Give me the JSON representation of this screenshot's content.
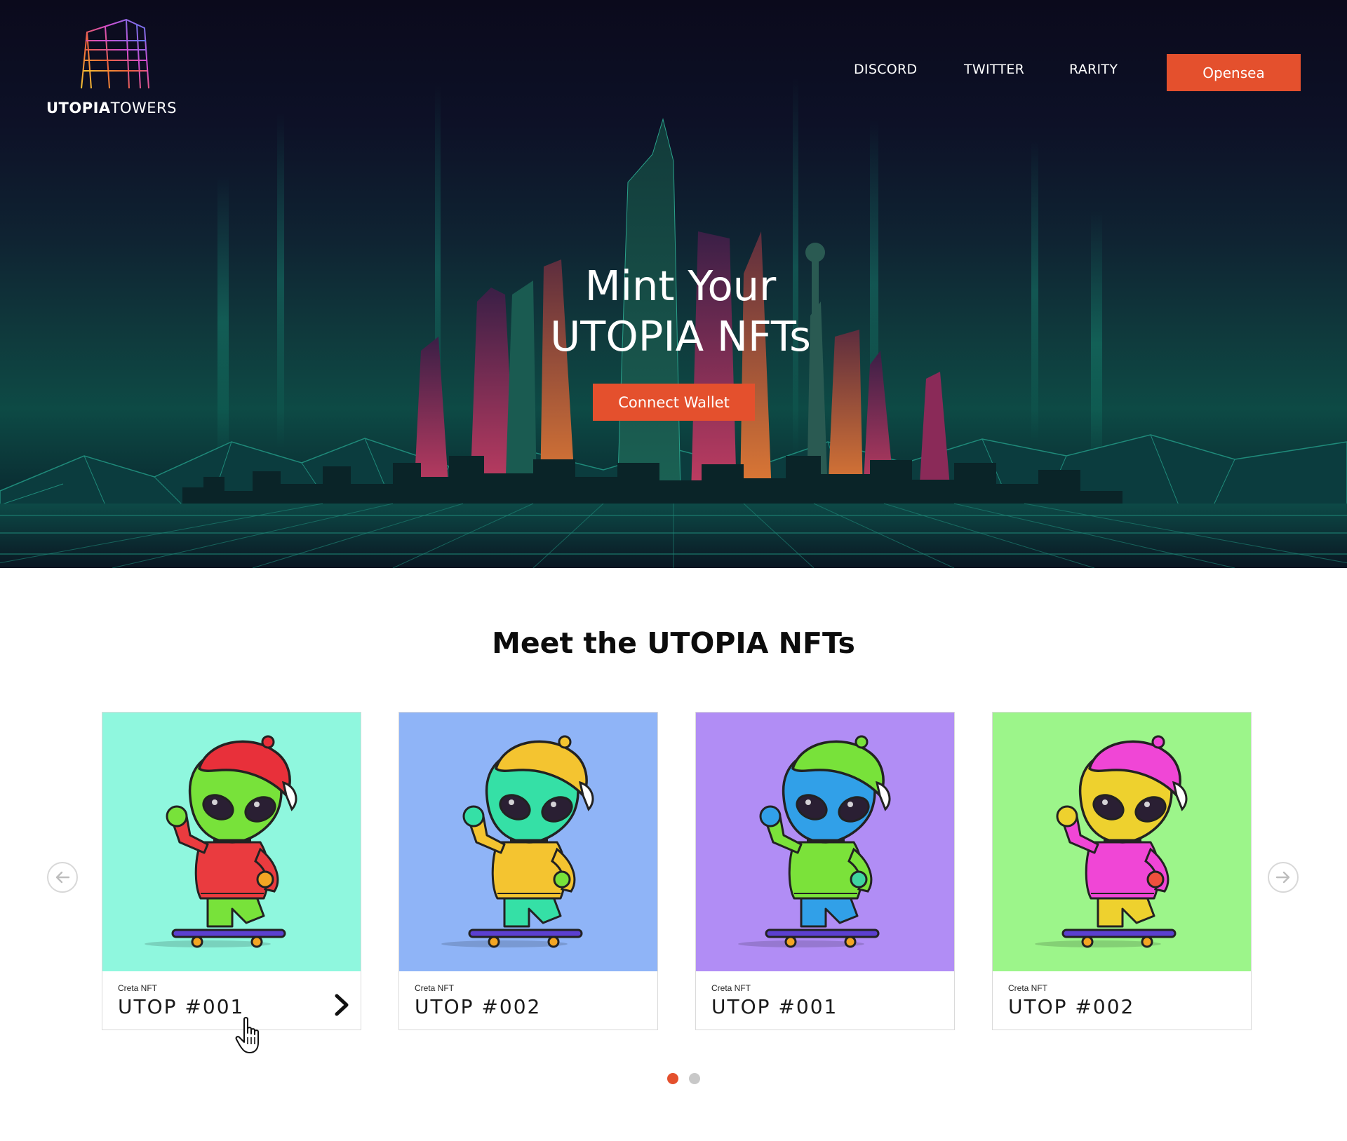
{
  "header": {
    "logo_text_bold": "UTOPIA",
    "logo_text_light": "TOWERS",
    "nav": [
      "DISCORD",
      "TWITTER",
      "RARITY"
    ],
    "cta": "Opensea"
  },
  "hero": {
    "title_line1": "Mint Your",
    "title_line2": "UTOPIA NFTs",
    "button": "Connect Wallet"
  },
  "gallery": {
    "title": "Meet the UTOPIA NFTs",
    "cards": [
      {
        "collection": "Creta NFT",
        "name": "UTOP #001",
        "bg": "#8ff7de",
        "cap": "#e8303a",
        "skin": "#78e23a",
        "shirt": "#ea3b3f",
        "pants": "#78e23a",
        "badge": "#f4a623"
      },
      {
        "collection": "Creta NFT",
        "name": "UTOP #002",
        "bg": "#8fb4f7",
        "cap": "#f4c430",
        "skin": "#35e0a6",
        "shirt": "#f4c430",
        "pants": "#35e0a6",
        "badge": "#78e23a"
      },
      {
        "collection": "Creta NFT",
        "name": "UTOP #001",
        "bg": "#b18df5",
        "cap": "#78e23a",
        "skin": "#31a0e8",
        "shirt": "#7be23a",
        "pants": "#31a0e8",
        "badge": "#3fd4a0"
      },
      {
        "collection": "Creta NFT",
        "name": "UTOP #002",
        "bg": "#9cf58a",
        "cap": "#f046d6",
        "skin": "#eed12e",
        "shirt": "#f046d6",
        "pants": "#eed12e",
        "badge": "#f0503d"
      }
    ],
    "pagination": {
      "active": 1,
      "total": 2
    }
  },
  "colors": {
    "accent": "#e4502d",
    "dot_inactive": "#c8c8c8"
  },
  "icons": [
    "logo-towers-icon",
    "arrow-left-icon",
    "arrow-right-icon",
    "chevron-right-icon",
    "hand-pointer-icon"
  ]
}
